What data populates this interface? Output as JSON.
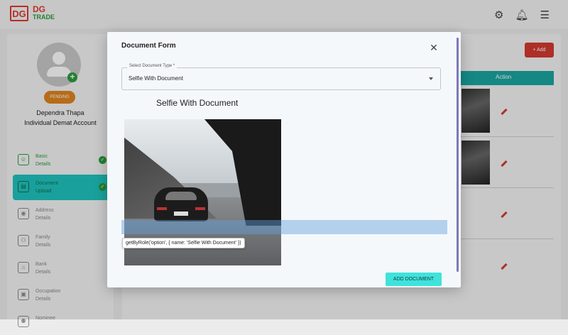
{
  "brand": {
    "mark": "DG",
    "line1": "DG",
    "line2": "TRADE"
  },
  "header": {
    "icons": [
      "gear-icon",
      "bell-icon",
      "menu-icon"
    ]
  },
  "profile": {
    "status": "PENDING",
    "name": "Dependra Thapa",
    "account_type": "Individual Demat Account"
  },
  "steps": [
    {
      "line1": "Basic",
      "line2": "Details",
      "state": "done",
      "icon": "person-icon"
    },
    {
      "line1": "Document",
      "line2": "Upload",
      "state": "active",
      "icon": "document-icon"
    },
    {
      "line1": "Address",
      "line2": "Details",
      "state": "todo",
      "icon": "location-icon"
    },
    {
      "line1": "Family",
      "line2": "Details",
      "state": "todo",
      "icon": "family-icon"
    },
    {
      "line1": "Bank",
      "line2": "Details",
      "state": "todo",
      "icon": "bank-icon"
    },
    {
      "line1": "Occupation",
      "line2": "Details",
      "state": "todo",
      "icon": "briefcase-icon"
    },
    {
      "line1": "Nominee",
      "line2": "",
      "state": "todo",
      "icon": "nominee-icon"
    }
  ],
  "main": {
    "add_button": "+ Add",
    "table_header": "Action"
  },
  "modal": {
    "title": "Document Form",
    "select": {
      "legend": "Select Document Type *",
      "value": "Selfie With Document"
    },
    "doc_heading": "Selfie With Document",
    "tooltip": "getByRole('option', { name: 'Selfie With Document' })",
    "submit_label": "ADD DOCUMENT"
  }
}
